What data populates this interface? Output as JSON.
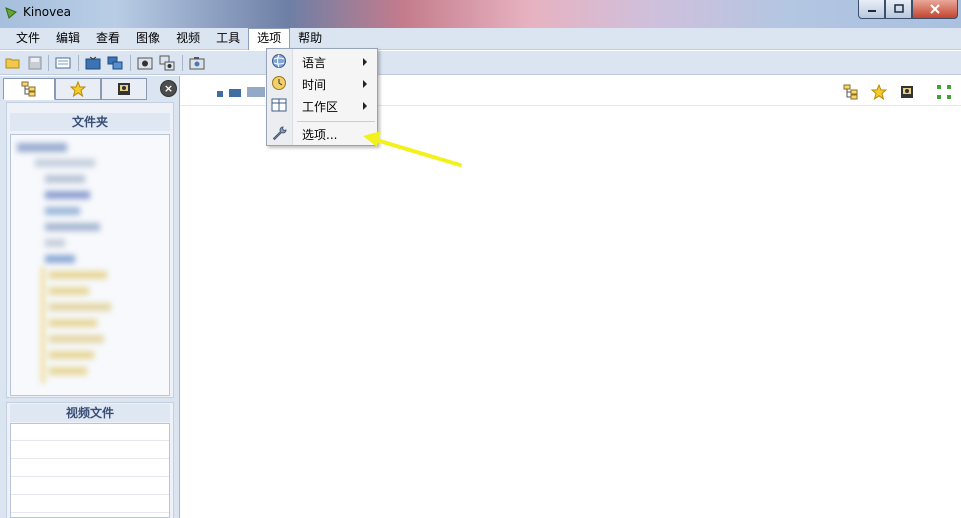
{
  "window": {
    "title": "Kinovea"
  },
  "menubar": {
    "items": [
      {
        "label": "文件"
      },
      {
        "label": "编辑"
      },
      {
        "label": "查看"
      },
      {
        "label": "图像"
      },
      {
        "label": "视频"
      },
      {
        "label": "工具"
      },
      {
        "label": "选项"
      },
      {
        "label": "帮助"
      }
    ]
  },
  "options_menu": {
    "items": [
      {
        "label": "语言",
        "icon": "globe-icon",
        "has_submenu": true
      },
      {
        "label": "时间",
        "icon": "clock-icon",
        "has_submenu": true
      },
      {
        "label": "工作区",
        "icon": "layout-icon",
        "has_submenu": true
      },
      {
        "label": "选项...",
        "icon": "wrench-icon",
        "has_submenu": false
      }
    ]
  },
  "left_panel": {
    "tabs": [
      {
        "icon": "folder-tree-icon",
        "active": true
      },
      {
        "icon": "star-icon",
        "active": false
      },
      {
        "icon": "camera-icon",
        "active": false
      }
    ],
    "folders_header": "文件夹",
    "files_header": "视频文件"
  },
  "colors": {
    "menubar_bg": "#dbe4f1",
    "header_text": "#3a4f76",
    "annotation_arrow": "#f3f11c"
  }
}
